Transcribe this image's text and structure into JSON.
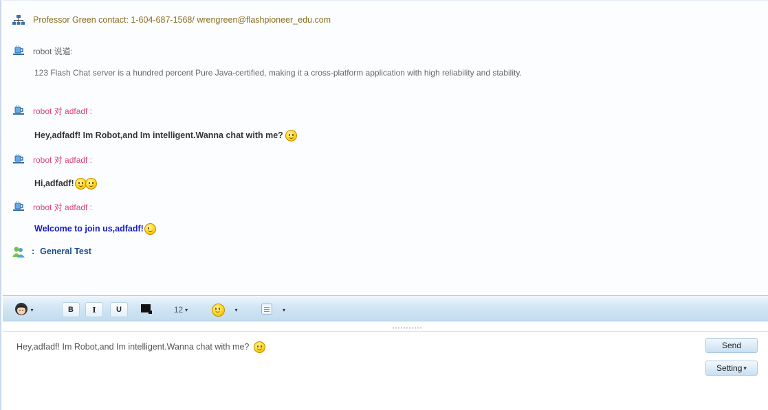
{
  "contact_line": "Professor Green contact: 1-604-687-1568/ wrengreen@flashpioneer_edu.com",
  "messages": [
    {
      "sender": "robot 说道:",
      "text": "123 Flash Chat server is a hundred percent Pure Java-certified, making it a cross-platform application with high reliability and stability."
    },
    {
      "sender": "robot 对 adfadf :",
      "text": "Hey,adfadf! Im Robot,and Im intelligent.Wanna chat with me?",
      "emoticons": [
        "smile"
      ]
    },
    {
      "sender": "robot 对 adfadf :",
      "text": "Hi,adfadf!",
      "emoticons": [
        "grin",
        "smile"
      ]
    },
    {
      "sender": "robot 对 adfadf :",
      "text": "Welcome to join us,adfadf!",
      "emoticons": [
        "wink"
      ]
    }
  ],
  "room": {
    "prefix": ":",
    "name": "General Test"
  },
  "toolbar": {
    "bold": "B",
    "italic": "I",
    "underline": "U",
    "font_size": "12",
    "dropdown_arrow": "▾"
  },
  "input": {
    "value": "Hey,adfadf! Im Robot,and Im intelligent.Wanna chat with me?",
    "emoticon": "smile"
  },
  "buttons": {
    "send": "Send",
    "setting": "Setting"
  },
  "colors": {
    "contact": "#8a6d1e",
    "sender": "#e0407a",
    "welcome": "#1a1acc",
    "toolbar": "#c2dcee"
  },
  "icons": [
    "network-icon",
    "robot-icon",
    "room-icon",
    "avatar-icon",
    "text-color-icon",
    "emoticon-icon",
    "alignment-icon"
  ]
}
